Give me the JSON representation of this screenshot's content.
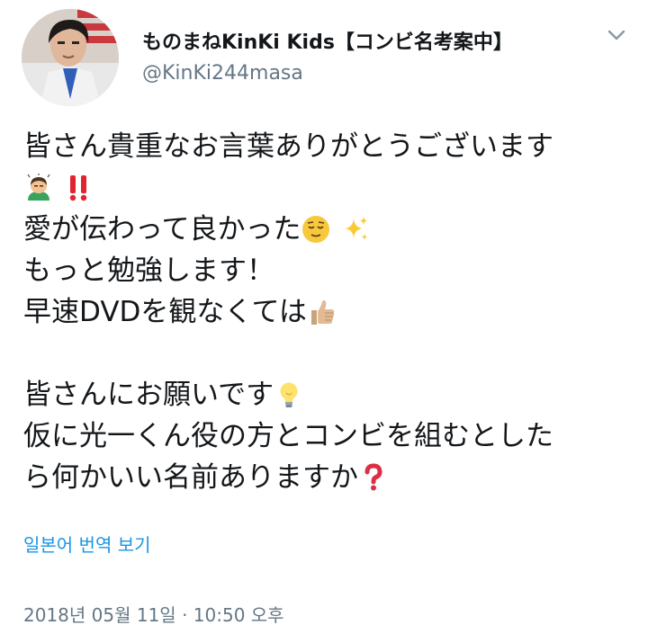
{
  "header": {
    "display_name": "ものまねKinKi Kids【コンビ名考案中】",
    "handle": "@KinKi244masa"
  },
  "tweet": {
    "line1": "皆さん貴重なお言葉ありがとうございます",
    "line2_emojis": [
      "person-bowing-icon",
      "double-exclamation-icon"
    ],
    "line3": "愛が伝わって良かった",
    "line3_emojis": [
      "relieved-face-icon",
      "sparkles-icon"
    ],
    "line4": "もっと勉強します！",
    "line5": "早速DVDを観なくては",
    "line5_emojis": [
      "thumbs-up-icon"
    ],
    "line7": "皆さんにお願いです",
    "line7_emojis": [
      "light-bulb-icon"
    ],
    "line8": "仮に光一くん役の方とコンビを組むとした",
    "line9": "ら何かいい名前ありますか",
    "line9_emojis": [
      "red-question-mark-icon"
    ]
  },
  "translate_label": "일본어 번역 보기",
  "timestamp": "2018년 05월 11일 · 10:50 오후",
  "colors": {
    "link": "#1b95e0",
    "secondary_text": "#657786",
    "primary_text": "#14171a"
  }
}
